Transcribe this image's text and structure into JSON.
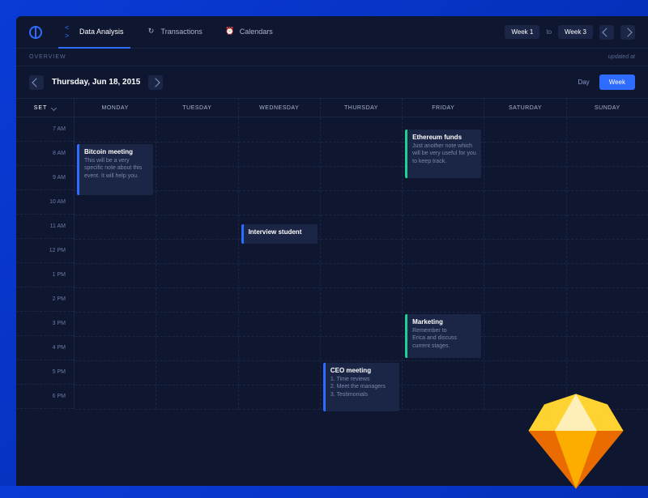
{
  "nav": {
    "items": [
      {
        "label": "Data Analysis",
        "icon": "< >"
      },
      {
        "label": "Transactions",
        "icon": "↻"
      },
      {
        "label": "Calendars",
        "icon": "⏰"
      }
    ],
    "active_index": 0
  },
  "range": {
    "from": "Week 1",
    "to_label": "to",
    "to": "Week 3"
  },
  "subbar": {
    "overview": "OVERVIEW",
    "updated": "updated at"
  },
  "datebar": {
    "date": "Thursday, Jun 18, 2015",
    "day_label": "Day",
    "week_label": "Week"
  },
  "header": {
    "set_label": "SET"
  },
  "days": [
    "MONDAY",
    "TUESDAY",
    "WEDNESDAY",
    "THURSDAY",
    "FRIDAY",
    "SATURDAY",
    "SUNDAY"
  ],
  "times": [
    "7 AM",
    "8 AM",
    "9 AM",
    "10 AM",
    "11 AM",
    "12 PM",
    "1 PM",
    "2 PM",
    "3 PM",
    "4 PM",
    "5 PM",
    "6 PM"
  ],
  "events": [
    {
      "day": 0,
      "start": 1,
      "span": 2.3,
      "color": "blue",
      "title": "Bitcoin meeting",
      "note": "This will be a very specific note about this event. It will help you."
    },
    {
      "day": 2,
      "start": 4.3,
      "span": 1,
      "color": "blue",
      "title": "Interview student",
      "note": ""
    },
    {
      "day": 3,
      "start": 10,
      "span": 2.2,
      "color": "blue",
      "title": "CEO meeting",
      "note": "1. Time reviews\n2. Meet the managers\n3. Testimonials"
    },
    {
      "day": 4,
      "start": 0.4,
      "span": 2.2,
      "color": "green",
      "title": "Ethereum funds",
      "note": "Just another note which will be very useful for you to keep track."
    },
    {
      "day": 4,
      "start": 8,
      "span": 2,
      "color": "green",
      "title": "Marketing",
      "note": "Remember to\nErica and discuss\ncurrent stages."
    }
  ],
  "colors": {
    "blue": "#2e6bff",
    "green": "#1fd18e",
    "bg_dark": "#0f1730",
    "panel": "#1b2545"
  }
}
